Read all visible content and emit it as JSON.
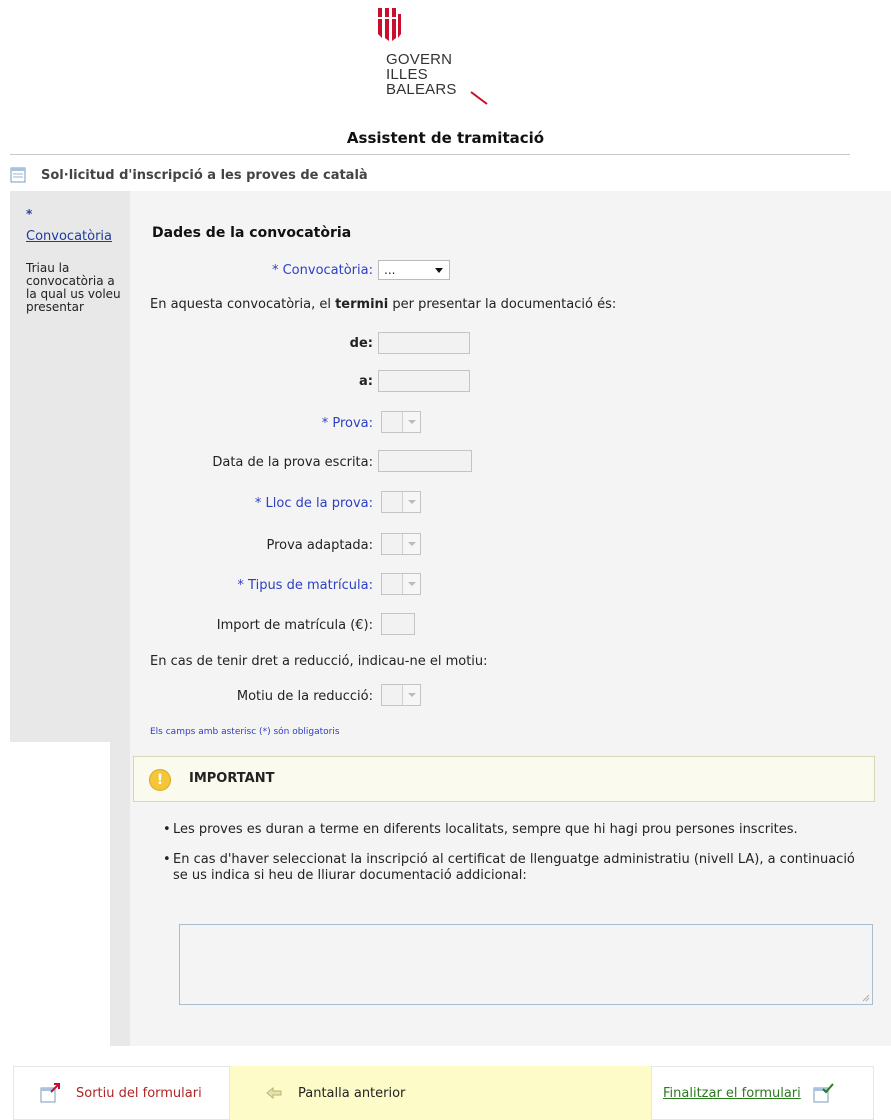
{
  "header": {
    "logo_lines": [
      "GOVERN",
      "ILLES",
      "BALEARS"
    ],
    "app_title": "Assistent de tramitació"
  },
  "form": {
    "title": "Sol·licitud d'inscripció a les proves de català"
  },
  "sidebar": {
    "star": "*",
    "step_label": "Convocatòria",
    "step_help": "Triau la convocatòria a la qual us voleu presentar"
  },
  "section": {
    "title": "Dades de la convocatòria",
    "convocatoria_label": "* Convocatòria:",
    "convocatoria_value": "...",
    "termini_pre": "En aquesta convocatòria, el ",
    "termini_bold": "termini",
    "termini_post": " per presentar la documentació és:",
    "de_label": "de:",
    "a_label": "a:",
    "prova_label": "* Prova:",
    "data_prova_label": "Data de la prova escrita:",
    "lloc_label": "* Lloc de la prova:",
    "adaptada_label": "Prova adaptada:",
    "tipus_label": "* Tipus de matrícula:",
    "import_label": "Import de matrícula (€):",
    "reduccio_text": "En cas de tenir dret a reducció, indicau-ne el motiu:",
    "motiu_label": "Motiu de la reducció:",
    "required_note": "Els camps amb asterisc (*) són obligatoris"
  },
  "important": {
    "title": "IMPORTANT",
    "bullet1": "Les proves es duran a terme en diferents localitats, sempre que hi hagi prou persones inscrites.",
    "bullet2": "En cas d'haver seleccionat la inscripció al certificat de llenguatge administratiu (nivell LA), a continuació se us indica si heu de lliurar documentació addicional:"
  },
  "footer": {
    "exit_label": "Sortiu del formulari",
    "back_label": "Pantalla anterior",
    "finish_label": "Finalitzar el formulari"
  },
  "colors": {
    "required_blue": "#2c3fc5",
    "logo_red": "#c8102e",
    "footer_yellow": "#fdfcc8"
  },
  "icons": [
    "govern-logo-icon",
    "document-icon",
    "warning-icon",
    "exit-icon",
    "back-arrow-icon",
    "finish-check-icon"
  ]
}
